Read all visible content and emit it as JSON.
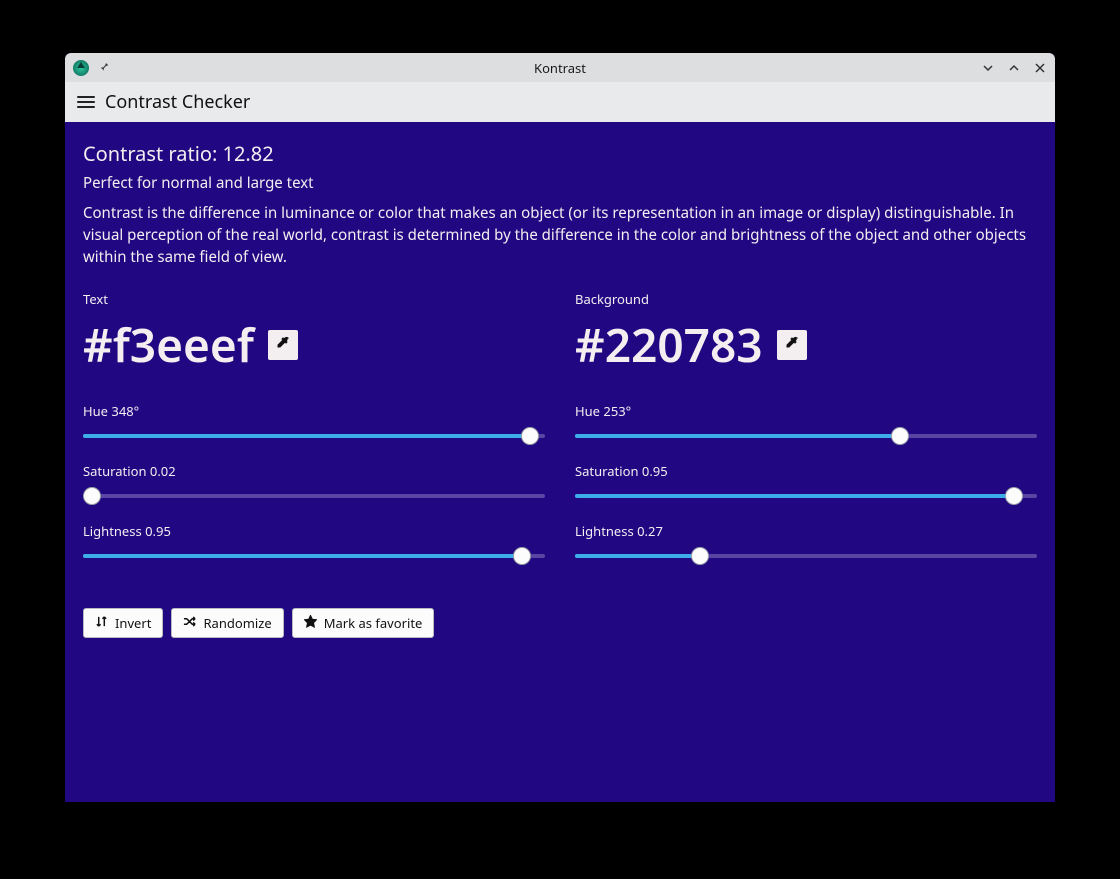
{
  "window": {
    "title": "Kontrast"
  },
  "toolbar": {
    "title": "Contrast Checker"
  },
  "ratio": {
    "label": "Contrast ratio: ",
    "value": "12.82"
  },
  "subtitle": "Perfect for normal and large text",
  "description": "Contrast is the difference in luminance or color that makes an object (or its representation in an image or display) distinguishable. In visual perception of the real world, contrast is determined by the difference in the color and brightness of the object and other objects within the same field of view.",
  "text_color": {
    "label": "Text",
    "hex": "#f3eeef",
    "hue": {
      "label": "Hue 348°",
      "value": 348,
      "max": 360
    },
    "saturation": {
      "label": "Saturation 0.02",
      "value": 0.02,
      "max": 1
    },
    "lightness": {
      "label": "Lightness 0.95",
      "value": 0.95,
      "max": 1
    }
  },
  "bg_color": {
    "label": "Background",
    "hex": "#220783",
    "hue": {
      "label": "Hue 253°",
      "value": 253,
      "max": 360
    },
    "saturation": {
      "label": "Saturation 0.95",
      "value": 0.95,
      "max": 1
    },
    "lightness": {
      "label": "Lightness 0.27",
      "value": 0.27,
      "max": 1
    }
  },
  "actions": {
    "invert": "Invert",
    "randomize": "Randomize",
    "favorite": "Mark as favorite"
  }
}
